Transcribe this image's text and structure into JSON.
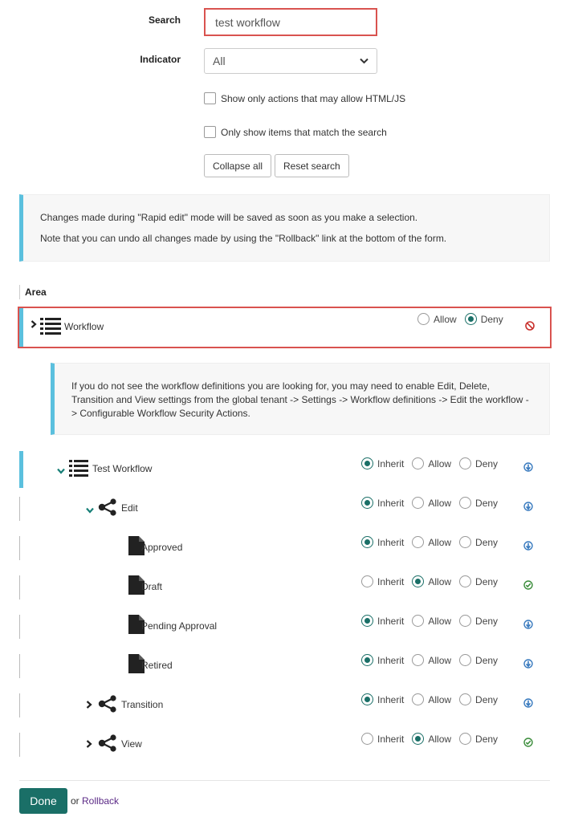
{
  "filters": {
    "search_label": "Search",
    "search_value": "test workflow",
    "indicator_label": "Indicator",
    "indicator_value": "All",
    "checkbox_html_js": "Show only actions that may allow HTML/JS",
    "checkbox_match": "Only show items that match the search",
    "collapse_all": "Collapse all",
    "reset_search": "Reset search"
  },
  "rapid_info": {
    "line1": "Changes made during \"Rapid edit\" mode will be saved as soon as you make a selection.",
    "line2": "Note that you can undo all changes made by using the \"Rollback\" link at the bottom of the form."
  },
  "area_header": "Area",
  "workflow_row": {
    "name": "Workflow",
    "options": [
      "Allow",
      "Deny"
    ],
    "selected": "Deny",
    "status_icon": "deny-circle-icon"
  },
  "workflow_info": "If you do not see the workflow definitions you are looking for, you may need to enable Edit, Delete, Transition and View settings from the global tenant -> Settings -> Workflow definitions -> Edit the workflow -> Configurable Workflow Security Actions.",
  "labels": {
    "inherit": "Inherit",
    "allow": "Allow",
    "deny": "Deny"
  },
  "tree": [
    {
      "name": "Test Workflow",
      "icon": "list-icon",
      "chevron": "down",
      "selected": "Inherit",
      "status": "inherit-icon"
    },
    {
      "name": "Edit",
      "icon": "share-icon",
      "chevron": "down",
      "selected": "Inherit",
      "status": "inherit-icon"
    },
    {
      "name": "Approved",
      "icon": "document-icon",
      "chevron": "none",
      "selected": "Inherit",
      "status": "inherit-icon"
    },
    {
      "name": "Draft",
      "icon": "document-icon",
      "chevron": "none",
      "selected": "Allow",
      "status": "allow-check-icon"
    },
    {
      "name": "Pending Approval",
      "icon": "document-icon",
      "chevron": "none",
      "selected": "Inherit",
      "status": "inherit-icon"
    },
    {
      "name": "Retired",
      "icon": "document-icon",
      "chevron": "none",
      "selected": "Inherit",
      "status": "inherit-icon"
    },
    {
      "name": "Transition",
      "icon": "share-icon",
      "chevron": "right",
      "selected": "Inherit",
      "status": "inherit-icon"
    },
    {
      "name": "View",
      "icon": "share-icon",
      "chevron": "right",
      "selected": "Allow",
      "status": "allow-check-icon"
    }
  ],
  "footer": {
    "done": "Done",
    "or": "or",
    "rollback": "Rollback"
  },
  "colors": {
    "accent": "#1a6f67",
    "info_bar": "#5bc0de",
    "highlight": "#d9534f",
    "deny": "#c9302c",
    "allow": "#3c8d3c",
    "inherit": "#3a7bbf"
  }
}
